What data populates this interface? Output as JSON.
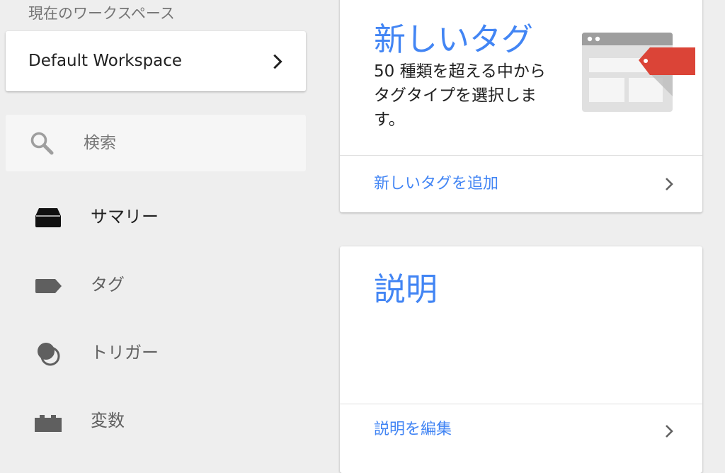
{
  "workspace": {
    "caption": "現在のワークスペース",
    "name": "Default Workspace",
    "chevron_icon": "chevron-right-icon"
  },
  "search": {
    "placeholder": "検索",
    "icon": "search-icon"
  },
  "nav": {
    "items": [
      {
        "label": "サマリー",
        "icon": "summary-icon",
        "active": true
      },
      {
        "label": "タグ",
        "icon": "tag-icon",
        "active": false
      },
      {
        "label": "トリガー",
        "icon": "trigger-icon",
        "active": false
      },
      {
        "label": "変数",
        "icon": "variables-icon",
        "active": false
      }
    ]
  },
  "new_tag_card": {
    "title": "新しいタグ",
    "description": "50 種類を超える中からタグタイプを選択します。",
    "action_label": "新しいタグを追加",
    "illustration": "tag-illustration"
  },
  "description_card": {
    "title": "説明",
    "action_label": "説明を編集"
  },
  "colors": {
    "accent": "#4285f4",
    "background": "#eeeeee",
    "tag_red": "#db4437"
  }
}
